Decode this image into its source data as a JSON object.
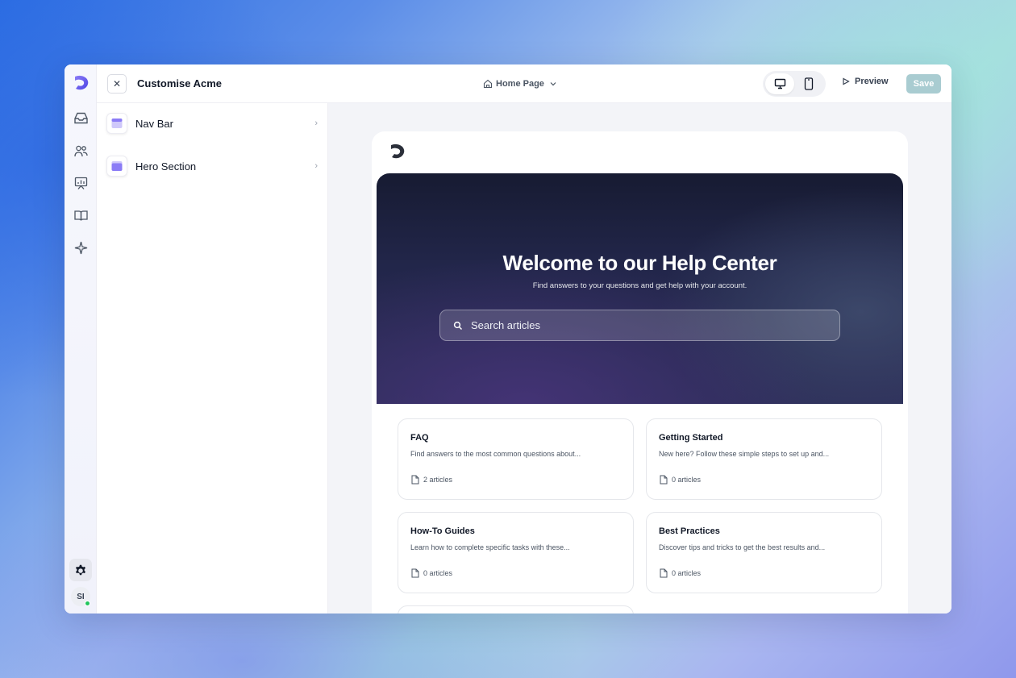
{
  "header": {
    "title": "Customise Acme",
    "close_icon": "close-icon",
    "page_select": "Home Page",
    "preview_label": "Preview",
    "save_label": "Save"
  },
  "rail": {
    "items": [
      "inbox-icon",
      "users-icon",
      "reports-icon",
      "knowledge-base-icon",
      "ai-sparkle-icon"
    ],
    "settings_icon": "gear-icon",
    "avatar_initials": "SI"
  },
  "sections": [
    {
      "label": "Nav Bar",
      "icon": "navbar-section-icon"
    },
    {
      "label": "Hero Section",
      "icon": "hero-section-icon"
    }
  ],
  "preview": {
    "hero_title": "Welcome to our Help Center",
    "hero_subtitle": "Find answers to your questions and get help with your account.",
    "search_placeholder": "Search articles",
    "collections": [
      {
        "title": "FAQ",
        "description": "Find answers to the most common questions about...",
        "count": "2 articles"
      },
      {
        "title": "Getting Started",
        "description": "New here? Follow these simple steps to set up and...",
        "count": "0 articles"
      },
      {
        "title": "How-To Guides",
        "description": "Learn how to complete specific tasks with these...",
        "count": "0 articles"
      },
      {
        "title": "Best Practices",
        "description": "Discover tips and tricks to get the best results and...",
        "count": "0 articles"
      }
    ]
  },
  "colors": {
    "accent": "#6d5ae6",
    "save_disabled": "#a9ccd1",
    "hero_dark": "#1c2040"
  }
}
